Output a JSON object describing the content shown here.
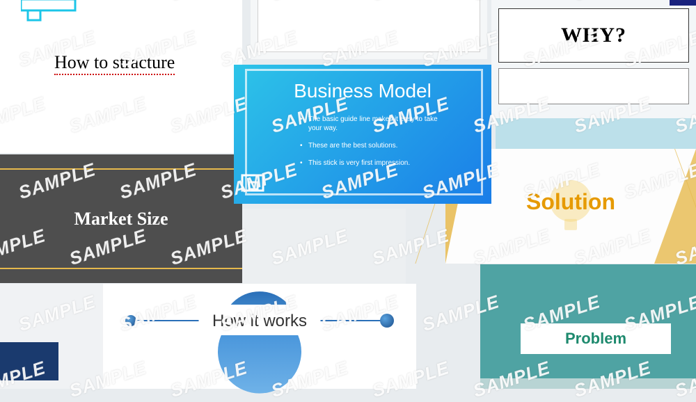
{
  "watermark_text": "SAMPLE",
  "slides": {
    "structure": {
      "title": "How to stracture"
    },
    "why": {
      "title": "WHY?"
    },
    "market": {
      "title": "Market Size"
    },
    "business": {
      "title": "Business Model",
      "bullets": [
        "The basic guide line makes it easy to take your way.",
        "These are the best solutions.",
        "This stick is very first impression."
      ]
    },
    "solution": {
      "title": "Solution"
    },
    "howworks": {
      "title": "How it works"
    },
    "problem": {
      "title": "Problem"
    }
  }
}
